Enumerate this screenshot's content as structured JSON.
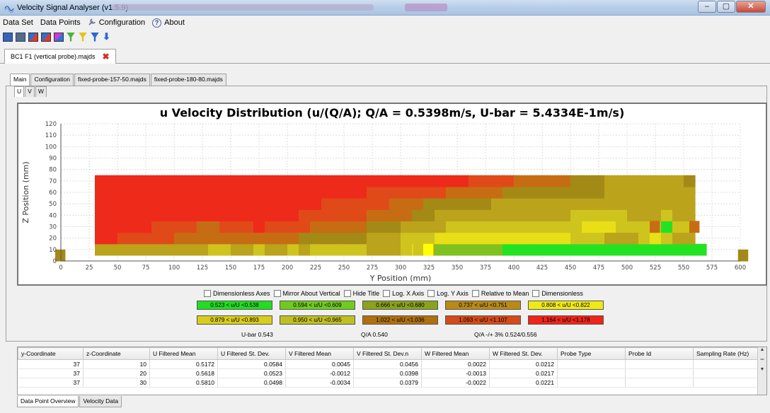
{
  "window": {
    "title": "Velocity Signal Analyser (v1.5.9)",
    "minimize": "–",
    "maximize": "▢",
    "close": "✕"
  },
  "menu": {
    "items": [
      "Data Set",
      "Data Points",
      "Configuration",
      "About"
    ],
    "about_glyph": "?"
  },
  "toolbar": {
    "icons": [
      "book-icon",
      "grid-icon",
      "chart-icon",
      "chart-icon",
      "chart-alt-icon",
      "filter-green-icon",
      "filter-yellow-icon",
      "filter-blue-icon",
      "arrow-down-icon"
    ],
    "arrow_glyph": "⬇"
  },
  "file_tab": {
    "label": "BC1 F1 (vertical probe).majds",
    "close_glyph": "✖"
  },
  "tabs": {
    "main": [
      "Main",
      "Configuration",
      "fixed-probe-157-50.majds",
      "fixed-probe-180-80.majds"
    ],
    "component": [
      "U",
      "V",
      "W"
    ]
  },
  "chart_data": {
    "type": "heatmap",
    "title": "u Velocity Distribution (u/(Q/A); Q/A = 0.5398m/s, U-bar = 5.4334E-1m/s)",
    "xlabel": "Y Position (mm)",
    "ylabel": "Z Position (mm)",
    "xlim": [
      0,
      600
    ],
    "ylim": [
      0,
      120
    ],
    "xticks": [
      "0",
      "25",
      "50",
      "75",
      "100",
      "125",
      "150",
      "175",
      "200",
      "225",
      "250",
      "275",
      "300",
      "325",
      "350",
      "375",
      "400",
      "425",
      "450",
      "475",
      "500",
      "525",
      "550",
      "575",
      "600"
    ],
    "yticks": [
      "0",
      "10",
      "20",
      "30",
      "40",
      "50",
      "60",
      "70",
      "80",
      "90",
      "100",
      "110",
      "120"
    ],
    "grid": true,
    "cells": {
      "y_start": 30,
      "y_step": 10,
      "z_levels": [
        10,
        20,
        30,
        40,
        50,
        60,
        70
      ],
      "ratio_rows_bottom_to_top": [
        "444444444455445445455555444564777777888888888888888888",
        "00111112222222222233333344455566666666666655544456544",
        "00000111122111011112222233344445555555555556665555855",
        "00000000000000000011111122223344444444444455555444544",
        "00000000000000000000111111222333333444444444444444444",
        "00000000000000000000000011111112222233333333344444444",
        "00000000000000000000000000000000011112222233344444443"
      ],
      "specials": [
        {
          "y": 316,
          "z": 10,
          "bin": 5
        },
        {
          "y": 325,
          "z": 10,
          "bin": 9
        },
        {
          "y": 525,
          "z": 30,
          "bin": 2
        },
        {
          "y": 560,
          "z": 30,
          "bin": 2
        },
        {
          "y": 0,
          "z": 5,
          "bin": 3
        },
        {
          "y": 603,
          "z": 5,
          "bin": 3
        }
      ]
    },
    "legend": [
      {
        "label": "0.523 < u/U <0.538",
        "color": "#22dd22"
      },
      {
        "label": "0.594 < u/U <0.609",
        "color": "#6fcc1c"
      },
      {
        "label": "0.666 < u/U <0.680",
        "color": "#8aa31a"
      },
      {
        "label": "0.737 < u/U <0.751",
        "color": "#b98a16"
      },
      {
        "label": "0.808 < u/U <0.822",
        "color": "#f0ea14"
      },
      {
        "label": "0.879 < u/U <0.893",
        "color": "#d8cd1c"
      },
      {
        "label": "0.950 < u/U <0.965",
        "color": "#bfbf20"
      },
      {
        "label": "1.022 < u/U <1.036",
        "color": "#b0700e"
      },
      {
        "label": "1.093 < u/U <1.107",
        "color": "#d44a18"
      },
      {
        "label": "1.164 < u/U <1.178",
        "color": "#ee2518"
      }
    ]
  },
  "cell_colors": [
    "#ee2a1a",
    "#e04a18",
    "#c66d14",
    "#a38a17",
    "#bba31c",
    "#cfc41e",
    "#e9df16",
    "#7fc11f",
    "#22e322",
    "#ffff00"
  ],
  "options": {
    "checkboxes": [
      "Dimensionless Axes",
      "Mirror About Vertical",
      "Hide Title",
      "Log. X Axis",
      "Log. Y Axis",
      "Relative to Mean",
      "Dimensionless"
    ]
  },
  "stats": {
    "ubar": "U-bar 0.543",
    "qa": "Q/A 0.540",
    "qa_range": "Q/A -/+ 3% 0.524/0.556"
  },
  "table": {
    "columns": [
      "y-Coordinate",
      "z-Coordinate",
      "U Filtered Mean",
      "U Filtered St. Dev.",
      "V Filtered Mean",
      "V Filtered St. Dev.n",
      "W Filtered Mean",
      "W Filtered St. Dev.",
      "Probe Type",
      "Probe Id",
      "Sampling Rate (Hz)"
    ],
    "rows": [
      [
        "37",
        "10",
        "0.5172",
        "0.0584",
        "0.0045",
        "0.0456",
        "0.0022",
        "0.0212",
        "",
        "",
        ""
      ],
      [
        "37",
        "20",
        "0.5618",
        "0.0523",
        "-0.0012",
        "0.0398",
        "-0.0013",
        "0.0217",
        "",
        "",
        ""
      ],
      [
        "37",
        "30",
        "0.5810",
        "0.0498",
        "-0.0034",
        "0.0379",
        "-0.0022",
        "0.0221",
        "",
        "",
        ""
      ]
    ]
  },
  "bottom_tabs": [
    "Data Point Overview",
    "Velocity Data"
  ]
}
